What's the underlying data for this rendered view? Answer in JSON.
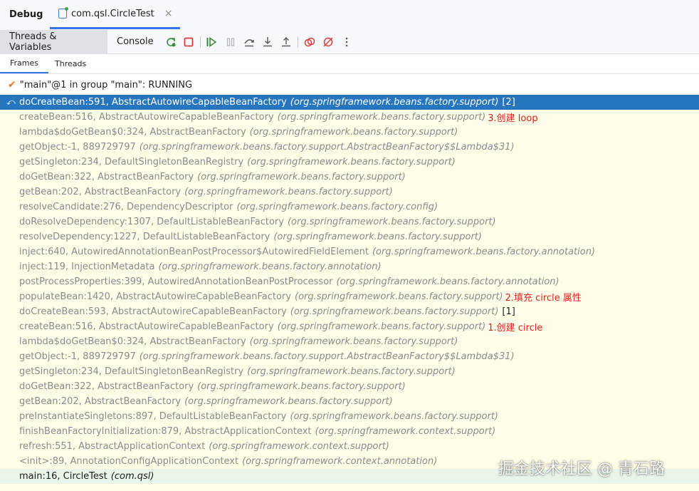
{
  "window": {
    "title": "Debug",
    "tab_label": "com.qsl.CircleTest",
    "tab_close": "×"
  },
  "toolbar": {
    "threads_variables_label": "Threads & Variables",
    "console_label": "Console",
    "icons": [
      "rerun-icon",
      "stop-icon",
      "resume-icon",
      "pause-icon",
      "step-over-icon",
      "step-into-icon",
      "step-out-icon",
      "view-breakpoints-icon",
      "mute-breakpoints-icon",
      "more-icon"
    ]
  },
  "subtabs": {
    "frames": "Frames",
    "threads": "Threads"
  },
  "thread": {
    "label": "\"main\"@1 in group \"main\": RUNNING"
  },
  "frames": [
    {
      "method": "doCreateBean:591, AbstractAutowireCapableBeanFactory",
      "pkg": "(org.springframework.beans.factory.support)",
      "mark": "[2]",
      "note": ""
    },
    {
      "method": "createBean:516, AbstractAutowireCapableBeanFactory",
      "pkg": "(org.springframework.beans.factory.support)",
      "mark": "",
      "note": "3.创建 loop"
    },
    {
      "method": "lambda$doGetBean$0:324, AbstractBeanFactory",
      "pkg": "(org.springframework.beans.factory.support)",
      "mark": "",
      "note": ""
    },
    {
      "method": "getObject:-1, 889729797",
      "pkg": "(org.springframework.beans.factory.support.AbstractBeanFactory$$Lambda$31)",
      "mark": "",
      "note": ""
    },
    {
      "method": "getSingleton:234, DefaultSingletonBeanRegistry",
      "pkg": "(org.springframework.beans.factory.support)",
      "mark": "",
      "note": ""
    },
    {
      "method": "doGetBean:322, AbstractBeanFactory",
      "pkg": "(org.springframework.beans.factory.support)",
      "mark": "",
      "note": ""
    },
    {
      "method": "getBean:202, AbstractBeanFactory",
      "pkg": "(org.springframework.beans.factory.support)",
      "mark": "",
      "note": ""
    },
    {
      "method": "resolveCandidate:276, DependencyDescriptor",
      "pkg": "(org.springframework.beans.factory.config)",
      "mark": "",
      "note": ""
    },
    {
      "method": "doResolveDependency:1307, DefaultListableBeanFactory",
      "pkg": "(org.springframework.beans.factory.support)",
      "mark": "",
      "note": ""
    },
    {
      "method": "resolveDependency:1227, DefaultListableBeanFactory",
      "pkg": "(org.springframework.beans.factory.support)",
      "mark": "",
      "note": ""
    },
    {
      "method": "inject:640, AutowiredAnnotationBeanPostProcessor$AutowiredFieldElement",
      "pkg": "(org.springframework.beans.factory.annotation)",
      "mark": "",
      "note": ""
    },
    {
      "method": "inject:119, InjectionMetadata",
      "pkg": "(org.springframework.beans.factory.annotation)",
      "mark": "",
      "note": ""
    },
    {
      "method": "postProcessProperties:399, AutowiredAnnotationBeanPostProcessor",
      "pkg": "(org.springframework.beans.factory.annotation)",
      "mark": "",
      "note": ""
    },
    {
      "method": "populateBean:1420, AbstractAutowireCapableBeanFactory",
      "pkg": "(org.springframework.beans.factory.support)",
      "mark": "",
      "note": "2.填充 circle 属性"
    },
    {
      "method": "doCreateBean:593, AbstractAutowireCapableBeanFactory",
      "pkg": "(org.springframework.beans.factory.support)",
      "mark": "[1]",
      "note": ""
    },
    {
      "method": "createBean:516, AbstractAutowireCapableBeanFactory",
      "pkg": "(org.springframework.beans.factory.support)",
      "mark": "",
      "note": "1.创建 circle"
    },
    {
      "method": "lambda$doGetBean$0:324, AbstractBeanFactory",
      "pkg": "(org.springframework.beans.factory.support)",
      "mark": "",
      "note": ""
    },
    {
      "method": "getObject:-1, 889729797",
      "pkg": "(org.springframework.beans.factory.support.AbstractBeanFactory$$Lambda$31)",
      "mark": "",
      "note": ""
    },
    {
      "method": "getSingleton:234, DefaultSingletonBeanRegistry",
      "pkg": "(org.springframework.beans.factory.support)",
      "mark": "",
      "note": ""
    },
    {
      "method": "doGetBean:322, AbstractBeanFactory",
      "pkg": "(org.springframework.beans.factory.support)",
      "mark": "",
      "note": ""
    },
    {
      "method": "getBean:202, AbstractBeanFactory",
      "pkg": "(org.springframework.beans.factory.support)",
      "mark": "",
      "note": ""
    },
    {
      "method": "preInstantiateSingletons:897, DefaultListableBeanFactory",
      "pkg": "(org.springframework.beans.factory.support)",
      "mark": "",
      "note": ""
    },
    {
      "method": "finishBeanFactoryInitialization:879, AbstractApplicationContext",
      "pkg": "(org.springframework.context.support)",
      "mark": "",
      "note": ""
    },
    {
      "method": "refresh:551, AbstractApplicationContext",
      "pkg": "(org.springframework.context.support)",
      "mark": "",
      "note": ""
    },
    {
      "method": "<init>:89, AnnotationConfigApplicationContext",
      "pkg": "(org.springframework.context.annotation)",
      "mark": "",
      "note": ""
    },
    {
      "method": "main:16, CircleTest",
      "pkg": "(com.qsl)",
      "mark": "",
      "note": ""
    }
  ],
  "colors": {
    "selection": "#2675bf",
    "note_red": "#e02020",
    "frame_bg": "#fdfde8",
    "accent": "#3574f0"
  },
  "watermark": "掘金技术社区 @ 青石路"
}
